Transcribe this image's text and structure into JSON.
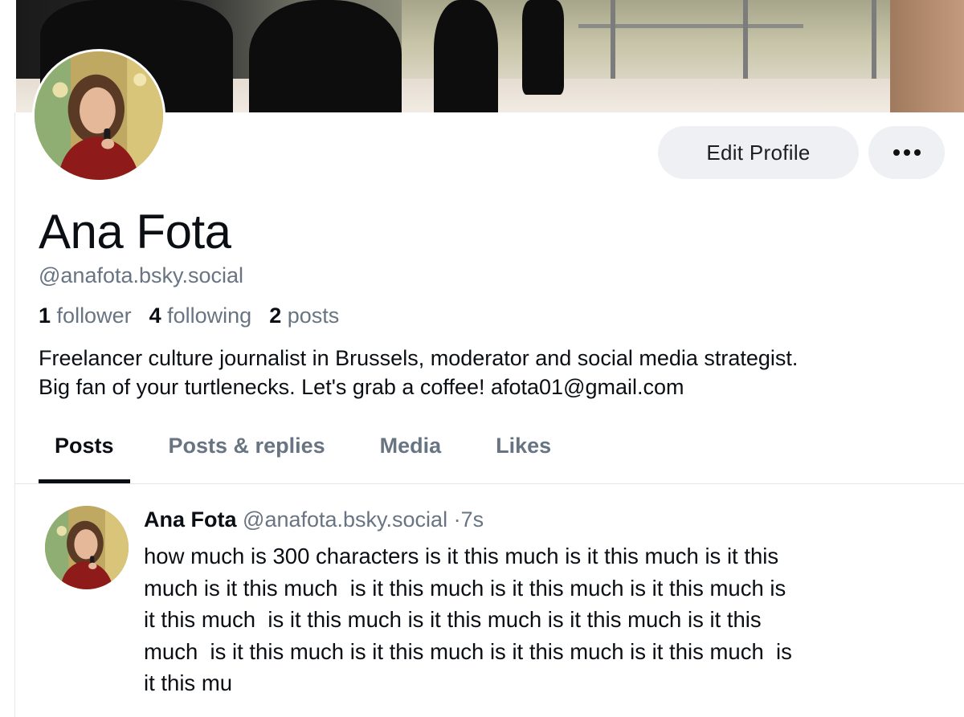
{
  "profile": {
    "name": "Ana Fota",
    "handle": "@anafota.bsky.social",
    "stats": {
      "followers_count": "1",
      "followers_label": "follower",
      "following_count": "4",
      "following_label": "following",
      "posts_count": "2",
      "posts_label": "posts"
    },
    "bio": "Freelancer culture journalist in Brussels, moderator and social media strategist.\nBig fan of your turtlenecks. Let's grab a coffee! afota01@gmail.com"
  },
  "actions": {
    "edit_profile_label": "Edit Profile",
    "more_icon": "ellipsis-icon"
  },
  "tabs": [
    {
      "label": "Posts",
      "active": true
    },
    {
      "label": "Posts & replies",
      "active": false
    },
    {
      "label": "Media",
      "active": false
    },
    {
      "label": "Likes",
      "active": false
    }
  ],
  "post": {
    "author_name": "Ana Fota",
    "author_handle": "@anafota.bsky.social",
    "separator": "·",
    "timestamp": "7s",
    "text": "how much is 300 characters is it this much is it this much is it this\nmuch is it this much  is it this much is it this much is it this much is\nit this much  is it this much is it this much is it this much is it this\nmuch  is it this much is it this much is it this much is it this much  is\nit this mu"
  },
  "colors": {
    "text_primary": "#0b0f14",
    "text_secondary": "#687482",
    "button_bg": "#eef0f3",
    "divider": "#e2e5e9"
  }
}
